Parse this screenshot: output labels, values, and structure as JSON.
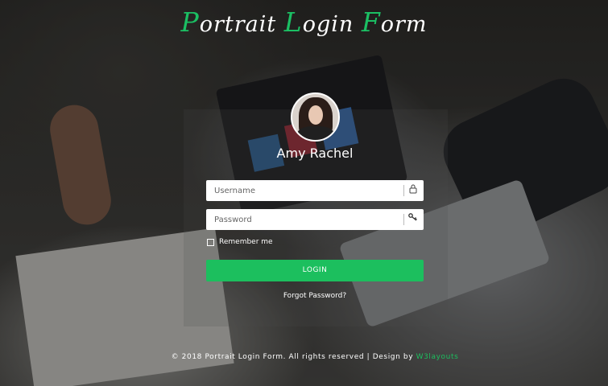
{
  "title": {
    "parts": [
      {
        "cap": "P",
        "rest": "ortrait "
      },
      {
        "cap": "L",
        "rest": "ogin "
      },
      {
        "cap": "F",
        "rest": "orm"
      }
    ]
  },
  "profile": {
    "name": "Amy Rachel"
  },
  "form": {
    "username_placeholder": "Username",
    "username_value": "",
    "password_placeholder": "Password",
    "password_value": "",
    "remember_label": "Remember me",
    "remember_checked": false,
    "login_label": "LOGIN",
    "forgot_label": "Forgot Password?"
  },
  "footer": {
    "text": "© 2018 Portrait Login Form. All rights reserved | Design by ",
    "link": "W3layouts"
  },
  "colors": {
    "accent": "#1cbf5e"
  },
  "icons": {
    "username": "user-lock-icon",
    "password": "key-icon"
  }
}
